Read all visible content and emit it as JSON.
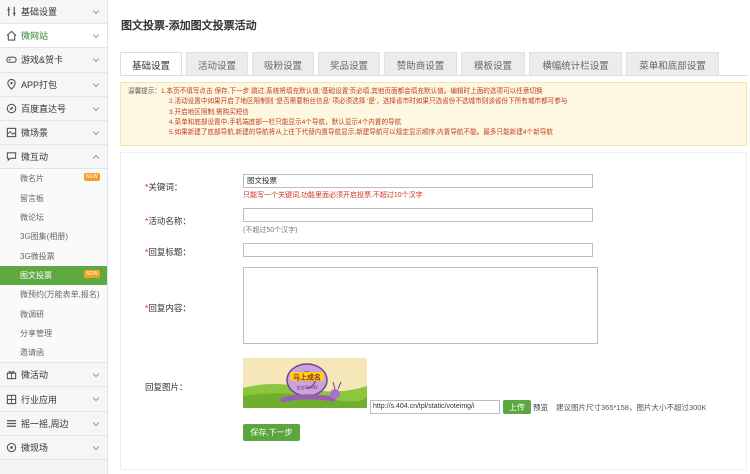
{
  "sidebar": {
    "items": [
      {
        "label": "基础设置",
        "icon": "settings-icon"
      },
      {
        "label": "微网站",
        "icon": "home-icon"
      },
      {
        "label": "游戏&贺卡",
        "icon": "game-icon"
      },
      {
        "label": "APP打包",
        "icon": "pin-icon"
      },
      {
        "label": "百度直达号",
        "icon": "compass-icon"
      },
      {
        "label": "微场景",
        "icon": "scene-icon"
      },
      {
        "label": "微互动",
        "icon": "chat-icon"
      }
    ],
    "sub_items": [
      {
        "label": "微名片",
        "badge": "NEW"
      },
      {
        "label": "留言板"
      },
      {
        "label": "微论坛"
      },
      {
        "label": "3G图集(相册)"
      },
      {
        "label": "3G微投票"
      },
      {
        "label": "图文投票",
        "badge": "NEW"
      },
      {
        "label": "微预约(万能表单,报名)"
      },
      {
        "label": "微调研"
      },
      {
        "label": "分享管理"
      },
      {
        "label": "邀请函"
      }
    ],
    "bottom_items": [
      {
        "label": "微活动",
        "icon": "gift-icon"
      },
      {
        "label": "行业应用",
        "icon": "grid-icon"
      },
      {
        "label": "摇一摇,周边",
        "icon": "shake-icon"
      },
      {
        "label": "微现场",
        "icon": "screen-icon"
      }
    ]
  },
  "page": {
    "title": "图文投票-添加图文投票活动"
  },
  "tabs": [
    "基础设置",
    "活动设置",
    "吸粉设置",
    "奖品设置",
    "赞助商设置",
    "模板设置",
    "横幅统计栏设置",
    "菜单和底部设置"
  ],
  "notice": {
    "label": "温馨提示：",
    "lines": [
      "1.本页不填写点击 保存,下一步 跳过,系统将填充默认值;'基础设置'页必填,其他页面都会填充默认值。编辑时上面的选项可以任意切换",
      "2.活动设置中如果开启了地区限制则 '是否需要粉丝信息' 项必须选择 '是'，选择省市时如果只选省份不选城市则该省份下所有城市都可参与",
      "3.开启地区限制,需购买短信",
      "4.菜单和底部设置中,手机端底部一栏只能显示4个导航，默认显示4个内置的导航",
      "5.如果新建了底部导航,新建的导航将从上往下代替内置导航显示,新建导航可以规定显示顺序,内置导航不能。最多只能新建4个新导航"
    ]
  },
  "form": {
    "keyword": {
      "label": "关键词：",
      "value": "图文投票",
      "hint": "只能写一个关键词,功能里面必须开启投票,不超过10个汉字"
    },
    "activity_name": {
      "label": "活动名称：",
      "value": "",
      "hint": "(不超过50个汉字)"
    },
    "reply_title": {
      "label": "回复标题：",
      "value": ""
    },
    "reply_content": {
      "label": "回复内容："
    },
    "reply_image": {
      "label": "回复图片：",
      "banner_text": "马上成名",
      "banner_subtext": "宝宝SHOW",
      "url": "http://s.404.cn/tpl/static/voteimg/i",
      "upload_label": "上传",
      "preview_label": "预览",
      "size_hint": "建议图片尺寸365*158，图片大小不超过300K"
    },
    "submit_label": "保存,下一步"
  },
  "colors": {
    "accent": "#5aa73f",
    "notice_text": "#c03c1c",
    "notice_bg": "#fef8e3"
  }
}
